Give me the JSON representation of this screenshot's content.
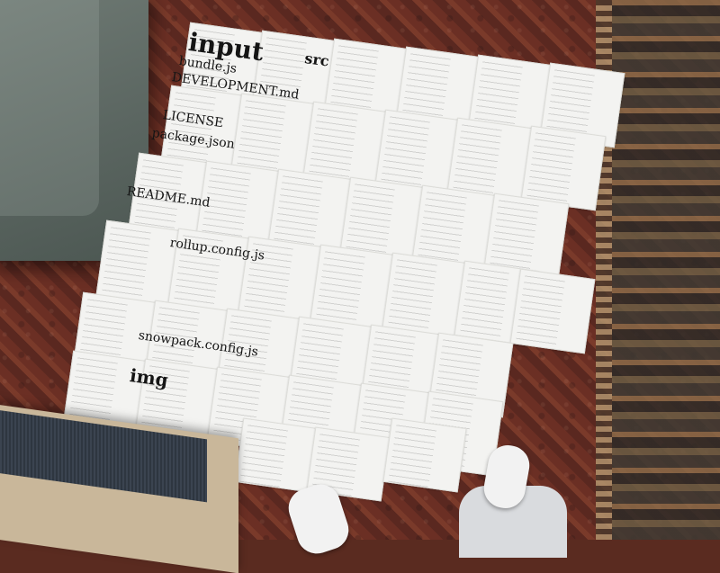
{
  "scene": {
    "big_labels": {
      "input": "input",
      "img": "img",
      "src": "src"
    },
    "file_labels": {
      "bundle": "bundle.js",
      "development": "DEVELOPMENT.md",
      "license": "LICENSE",
      "package": "package.json",
      "readme": "README.md",
      "rollup": "rollup.config.js",
      "snowpack": "snowpack.config.js"
    }
  }
}
